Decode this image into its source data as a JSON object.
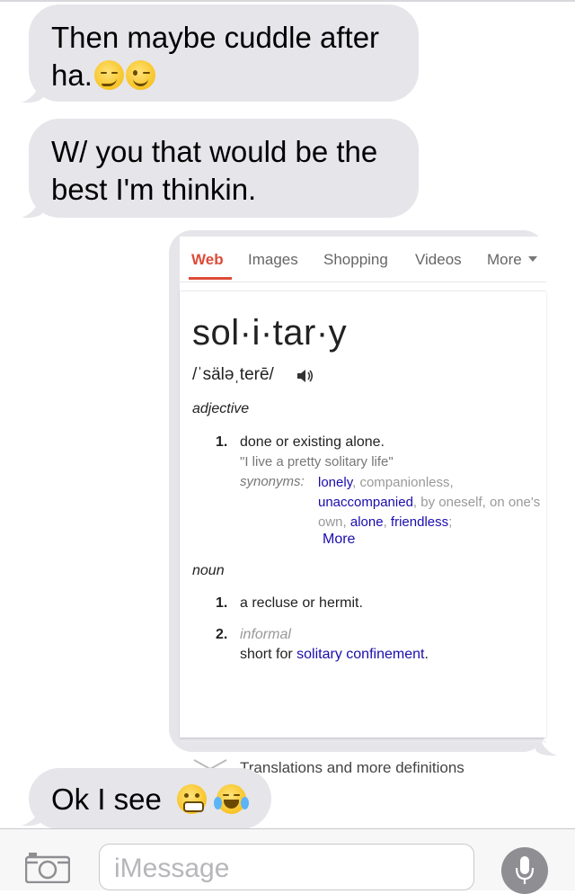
{
  "messages": [
    {
      "lines": [
        "Then maybe cuddle after",
        "ha."
      ],
      "emoji": [
        "smirk-emoji",
        "wink-emoji"
      ]
    },
    {
      "lines": [
        "W/ you that would be the",
        "best I'm thinkin."
      ]
    },
    {
      "text": "Ok I see",
      "emoji": [
        "grimace-emoji",
        "tears-of-joy-emoji"
      ]
    }
  ],
  "screenshot": {
    "tabs": [
      "Web",
      "Images",
      "Shopping",
      "Videos",
      "More"
    ],
    "active_tab": "Web",
    "word": "sol·i·tar·y",
    "pronunciation": "/ˈsäləˌterē/",
    "adjective": {
      "label": "adjective",
      "number": "1.",
      "definition": "done or existing alone.",
      "example": "\"I live a pretty solitary life\"",
      "synonyms_label": "synonyms:",
      "synonyms": [
        "lonely",
        "companionless",
        "unaccompanied",
        "by oneself",
        "on one's own",
        "alone",
        "friendless"
      ],
      "more": "More"
    },
    "noun": {
      "label": "noun",
      "def1_number": "1.",
      "def1": "a recluse or hermit.",
      "def2_number": "2.",
      "def2_tag": "informal",
      "def2_prefix": "short for",
      "def2_link": "solitary confinement",
      "def2_suffix": "."
    },
    "translations": "Translations and more definitions"
  },
  "input": {
    "placeholder": "iMessage"
  },
  "colors": {
    "bubble_gray": "#e5e5ea",
    "google_red": "#dd4b39",
    "link_blue": "#1a0dab"
  }
}
